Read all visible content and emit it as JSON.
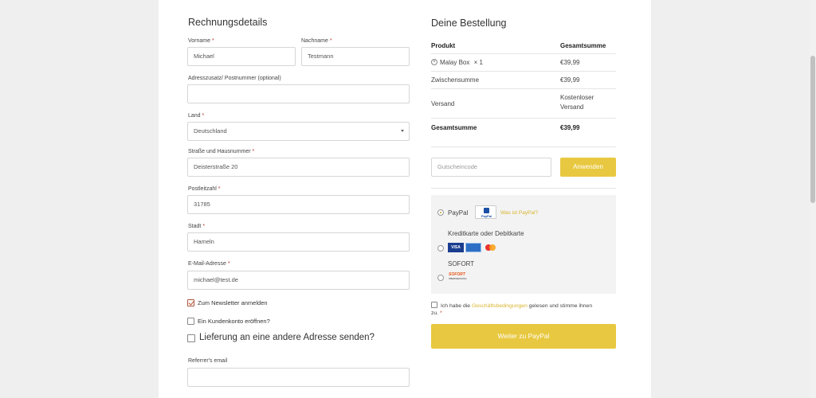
{
  "billing": {
    "title": "Rechnungsdetails",
    "first_name_label": "Vorname",
    "first_name_value": "Michael",
    "last_name_label": "Nachname",
    "last_name_value": "Testmann",
    "address2_label": "Adresszusatz/ Postnummer (optional)",
    "address2_value": "",
    "country_label": "Land",
    "country_value": "Deutschland",
    "street_label": "Straße und Hausnummer",
    "street_value": "Deisterstraße 20",
    "zip_label": "Postleitzahl",
    "zip_value": "31785",
    "city_label": "Stadt",
    "city_value": "Hameln",
    "email_label": "E-Mail-Adresse",
    "email_value": "michael@test.de",
    "required_mark": "*",
    "newsletter_label": "Zum Newsletter anmelden",
    "newsletter_checked": true,
    "account_label": "Ein Kundenkonto eröffnen?",
    "account_checked": false,
    "ship_different_label": "Lieferung an eine andere Adresse senden?",
    "referrer_label": "Referrer's email",
    "referrer_value": ""
  },
  "order": {
    "title": "Deine Bestellung",
    "col_product": "Produkt",
    "col_total": "Gesamtsumme",
    "item_name": "Malay Box",
    "item_qty": "× 1",
    "item_price": "€39,99",
    "subtotal_label": "Zwischensumme",
    "subtotal_value": "€39,99",
    "shipping_label": "Versand",
    "shipping_value_line1": "Kostenloser",
    "shipping_value_line2": "Versand",
    "total_label": "Gesamtsumme",
    "total_value": "€39,99",
    "coupon_placeholder": "Gutscheincode",
    "coupon_button": "Anwenden"
  },
  "payment": {
    "paypal_label": "PayPal",
    "paypal_logo_text": "PayPal",
    "paypal_link": "Was ist PayPal?",
    "card_label": "Kreditkarte oder Debitkarte",
    "visa_text": "VISA",
    "sofort_label": "SOFORT",
    "sofort_logo_text": "SOFORT",
    "sofort_logo_sub": "ÜBERWEISUNG",
    "terms_prefix": "Ich habe die",
    "terms_link": "Geschäftsbedingungen",
    "terms_suffix": "gelesen und stimme ihnen",
    "terms_line2": "zu.",
    "submit_button": "Weiter zu PayPal"
  },
  "colors": {
    "accent": "#e8c840",
    "required": "#c0392b",
    "link": "#d9b42d"
  }
}
